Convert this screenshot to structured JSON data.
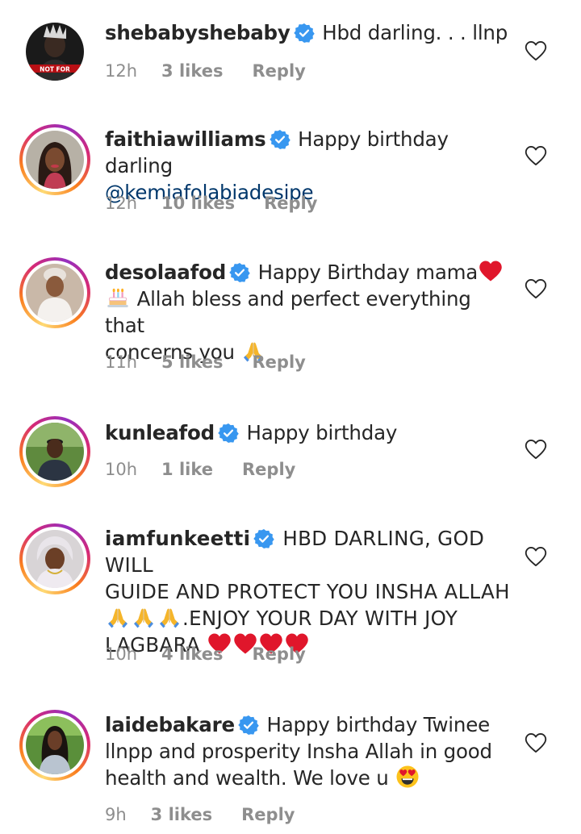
{
  "comments": [
    {
      "username": "shebabyshebaby",
      "text": "Hbd darling. . . llnp",
      "time": "12h",
      "likes": "3 likes",
      "reply": "Reply",
      "avatar_text": "NOT FOR"
    },
    {
      "username": "faithiawilliams",
      "text": "Happy birthday darling",
      "mention": "@kemiafolabiadesipe",
      "time": "12h",
      "likes": "10 likes",
      "reply": "Reply"
    },
    {
      "username": "desolaafod",
      "text_line1": "Happy Birthday mama",
      "text_line2": "Allah bless and perfect everything that",
      "text_line3": "concerns you",
      "time": "11h",
      "likes": "5 likes",
      "reply": "Reply"
    },
    {
      "username": "kunleafod",
      "text": "Happy birthday",
      "time": "10h",
      "likes": "1 like",
      "reply": "Reply"
    },
    {
      "username": "iamfunkeetti",
      "text_line1": "HBD DARLING, GOD WILL",
      "text_line2": "GUIDE AND PROTECT YOU INSHA ALLAH",
      "text_line3": ".ENJOY YOUR DAY WITH JOY",
      "text_line4": "LAGBARA",
      "time": "10h",
      "likes": "4 likes",
      "reply": "Reply"
    },
    {
      "username": "laidebakare",
      "text_line1": "Happy birthday Twinee",
      "text_line2": "llnpp and prosperity Insha Allah in good",
      "text_line3": "health and wealth. We love u",
      "time": "9h",
      "likes": "3 likes",
      "reply": "Reply"
    }
  ],
  "icons": {
    "verified": "verified-badge-icon",
    "like": "heart-outline-icon"
  },
  "colors": {
    "verified": "#3897f0",
    "secondary": "#8e8e8e",
    "mention": "#00376b",
    "heart": "#e0162b"
  }
}
